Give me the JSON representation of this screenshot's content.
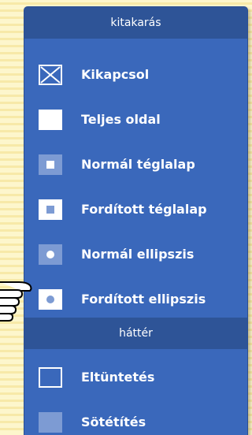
{
  "sections": [
    {
      "title": "kitakarás",
      "items": [
        {
          "label": "Kikapcsol",
          "icon": "off-x-icon"
        },
        {
          "label": "Teljes oldal",
          "icon": "full-page-icon"
        },
        {
          "label": "Normál téglalap",
          "icon": "normal-rectangle-icon"
        },
        {
          "label": "Fordított téglalap",
          "icon": "inverted-rectangle-icon"
        },
        {
          "label": "Normál ellipszis",
          "icon": "normal-ellipse-icon"
        },
        {
          "label": "Fordított ellipszis",
          "icon": "inverted-ellipse-icon"
        }
      ]
    },
    {
      "title": "háttér",
      "items": [
        {
          "label": "Eltüntetés",
          "icon": "hide-background-icon"
        },
        {
          "label": "Sötétítés",
          "icon": "darken-background-icon"
        }
      ]
    }
  ],
  "colors": {
    "panel": "#3a68bb",
    "header": "#2e5497",
    "page_background": "#fdf4c8",
    "text": "#ffffff"
  },
  "pointer_icon": "hand-pointer-icon"
}
